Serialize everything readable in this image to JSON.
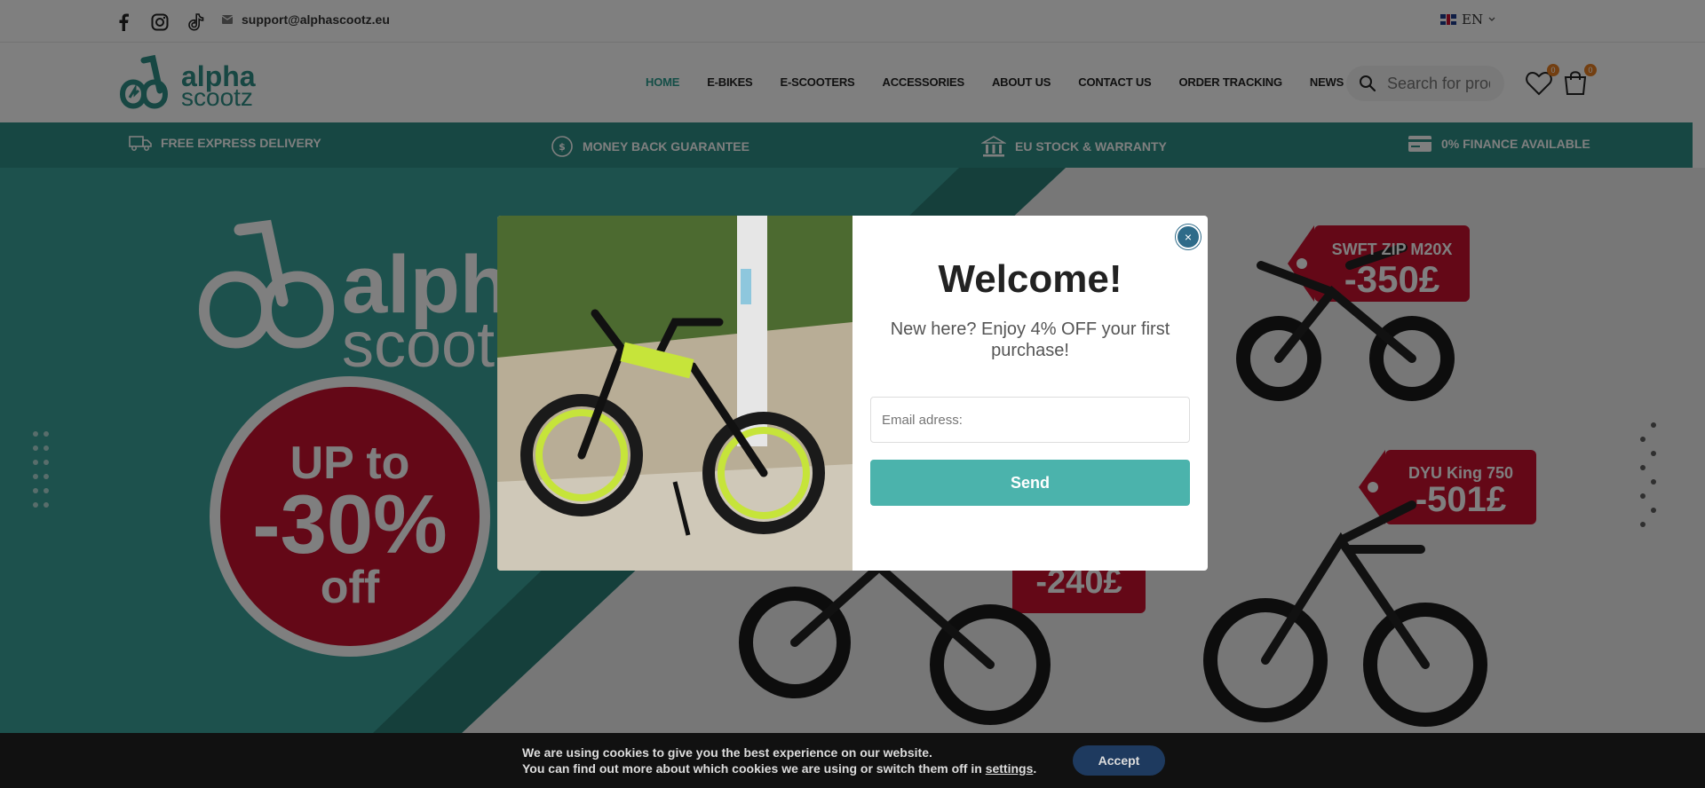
{
  "topbar": {
    "social": [
      "facebook-icon",
      "instagram-icon",
      "tiktok-icon"
    ],
    "email": "support@alphascootz.eu",
    "language": "EN"
  },
  "header": {
    "logo_top": "alpha",
    "logo_bottom": "scootz",
    "nav": [
      "HOME",
      "E-BIKES",
      "E-SCOOTERS",
      "ACCESSORIES",
      "ABOUT US",
      "CONTACT US",
      "ORDER TRACKING",
      "NEWS"
    ],
    "active_nav": "HOME",
    "search_placeholder": "Search for products",
    "wishlist_count": "0",
    "cart_count": "0"
  },
  "features": [
    {
      "icon": "truck-icon",
      "label": "FREE EXPRESS DELIVERY"
    },
    {
      "icon": "coin-icon",
      "label": "MONEY BACK GUARANTEE"
    },
    {
      "icon": "bank-icon",
      "label": "EU STOCK & WARRANTY"
    },
    {
      "icon": "card-icon",
      "label": "0% FINANCE AVAILABLE"
    }
  ],
  "hero": {
    "logo_top": "alpha",
    "logo_bottom": "scootz",
    "promo_line1": "UP to",
    "promo_line2": "-30%",
    "promo_line3": "off",
    "tag1_name": "SWFT ZIP M20X",
    "tag1_price": "-350£",
    "tag2_name": "DYU King 750",
    "tag2_price": "-501£",
    "tag3_price": "-240£"
  },
  "modal": {
    "title": "Welcome!",
    "subtitle": "New here? Enjoy 4% OFF your first purchase!",
    "email_placeholder": "Email adress:",
    "send_label": "Send",
    "close_label": "×"
  },
  "cookie": {
    "line1": "We are using cookies to give you the best experience on our website.",
    "line2_prefix": "You can find out more about which cookies we are using or switch them off in ",
    "line2_link": "settings",
    "line2_suffix": ".",
    "accept_label": "Accept"
  },
  "colors": {
    "brand_teal": "#2e8f86",
    "send_button": "#4bb3ac",
    "close_button": "#2e6b89",
    "promo_red": "#c8102e"
  }
}
